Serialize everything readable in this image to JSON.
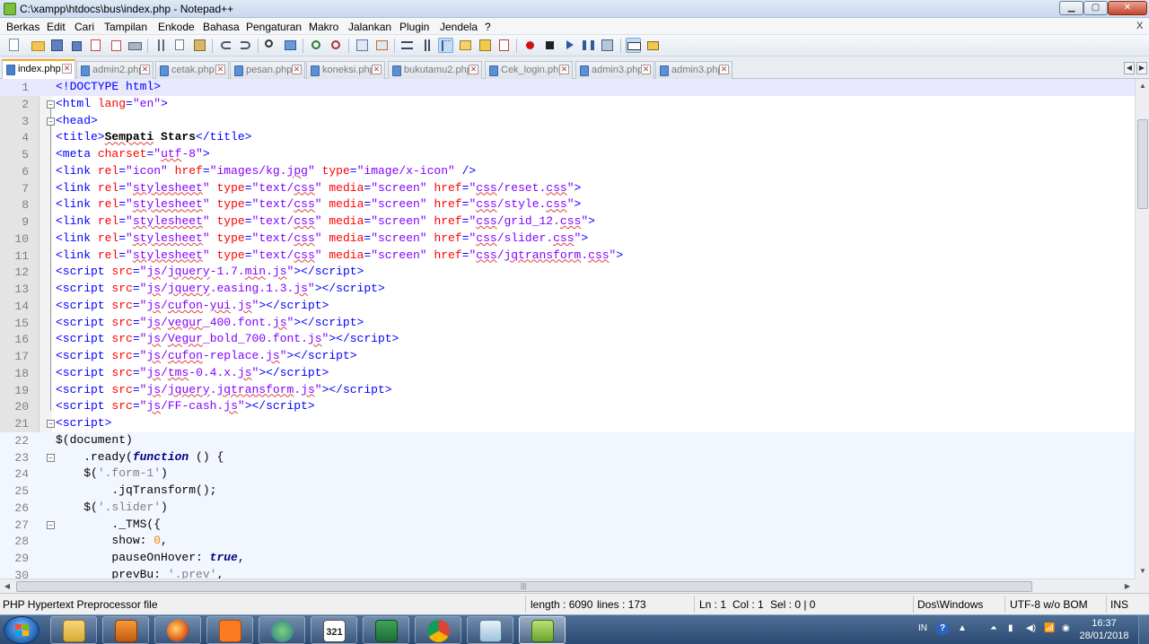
{
  "window": {
    "title": "C:\\xampp\\htdocs\\bus\\index.php - Notepad++",
    "min_glyph": "▁",
    "max_glyph": "▢",
    "close_glyph": "✕"
  },
  "menu": {
    "items": [
      "Berkas",
      "Edit",
      "Cari",
      "Tampilan",
      "Enkode",
      "Bahasa",
      "Pengaturan",
      "Makro",
      "Jalankan",
      "Plugin",
      "Jendela",
      "?"
    ],
    "close_doc_glyph": "X"
  },
  "toolbar": {
    "buttons": [
      "new-file",
      "open-file",
      "save",
      "save-all",
      "close",
      "close-all",
      "print",
      "cut",
      "copy",
      "paste",
      "undo",
      "redo",
      "find",
      "replace",
      "zoom-in",
      "zoom-out",
      "sync-vertical",
      "sync-horizontal",
      "word-wrap",
      "show-all-chars",
      "indent-guide",
      "udl",
      "doc-map",
      "function-list",
      "folder-workspace",
      "record-macro",
      "stop-recording",
      "play-macro",
      "run-macro-multiple",
      "save-macro",
      "spell-check",
      "spell-check-settings"
    ]
  },
  "tabs": [
    {
      "label": "index.php",
      "active": true
    },
    {
      "label": "admin2.php",
      "active": false
    },
    {
      "label": "cetak.php",
      "active": false
    },
    {
      "label": "pesan.php",
      "active": false
    },
    {
      "label": "koneksi.php",
      "active": false
    },
    {
      "label": "bukutamu2.php",
      "active": false
    },
    {
      "label": "Cek_login.php",
      "active": false
    },
    {
      "label": "admin3.php",
      "active": false
    },
    {
      "label": "admin3.php",
      "active": false
    }
  ],
  "tab_close_glyph": "✕",
  "tab_nav": {
    "left": "◀",
    "right": "▶"
  },
  "editor": {
    "lines": [
      {
        "n": "1",
        "html": "<span class=\"s-tag\">&lt;!DOCTYPE html&gt;</span>"
      },
      {
        "n": "2",
        "html": "<span class=\"s-tag\">&lt;html</span> <span class=\"s-attr\">lang</span><span class=\"s-tag\">=</span><span class=\"s-val\">\"en\"</span><span class=\"s-tag\">&gt;</span>"
      },
      {
        "n": "3",
        "html": "<span class=\"s-tag\">&lt;head&gt;</span>"
      },
      {
        "n": "4",
        "html": "<span class=\"s-tag\">&lt;title&gt;</span><span class=\"s-bold\"><span class=\"sq\">Sempati</span> Stars</span><span class=\"s-tag\">&lt;/title&gt;</span>"
      },
      {
        "n": "5",
        "html": "<span class=\"s-tag\">&lt;meta</span> <span class=\"s-attr\">charset</span><span class=\"s-tag\">=</span><span class=\"s-val\">\"<span class=\"sq\">utf</span>-8\"</span><span class=\"s-tag\">&gt;</span>"
      },
      {
        "n": "6",
        "html": "<span class=\"s-tag\">&lt;link</span> <span class=\"s-attr\">rel</span><span class=\"s-tag\">=</span><span class=\"s-val\">\"icon\"</span> <span class=\"s-attr\">href</span><span class=\"s-tag\">=</span><span class=\"s-val\">\"images/kg.<span class=\"sq\">jpg</span>\"</span> <span class=\"s-attr\">type</span><span class=\"s-tag\">=</span><span class=\"s-val\">\"image/x-icon\"</span> <span class=\"s-tag\">/&gt;</span>"
      },
      {
        "n": "7",
        "html": "<span class=\"s-tag\">&lt;link</span> <span class=\"s-attr\">rel</span><span class=\"s-tag\">=</span><span class=\"s-val\">\"<span class=\"sq\">stylesheet</span>\"</span> <span class=\"s-attr\">type</span><span class=\"s-tag\">=</span><span class=\"s-val\">\"text/<span class=\"sq\">css</span>\"</span> <span class=\"s-attr\">media</span><span class=\"s-tag\">=</span><span class=\"s-val\">\"screen\"</span> <span class=\"s-attr\">href</span><span class=\"s-tag\">=</span><span class=\"s-val\">\"<span class=\"sq\">css</span>/reset.<span class=\"sq\">css</span>\"</span><span class=\"s-tag\">&gt;</span>"
      },
      {
        "n": "8",
        "html": "<span class=\"s-tag\">&lt;link</span> <span class=\"s-attr\">rel</span><span class=\"s-tag\">=</span><span class=\"s-val\">\"<span class=\"sq\">stylesheet</span>\"</span> <span class=\"s-attr\">type</span><span class=\"s-tag\">=</span><span class=\"s-val\">\"text/<span class=\"sq\">css</span>\"</span> <span class=\"s-attr\">media</span><span class=\"s-tag\">=</span><span class=\"s-val\">\"screen\"</span> <span class=\"s-attr\">href</span><span class=\"s-tag\">=</span><span class=\"s-val\">\"<span class=\"sq\">css</span>/style.<span class=\"sq\">css</span>\"</span><span class=\"s-tag\">&gt;</span>"
      },
      {
        "n": "9",
        "html": "<span class=\"s-tag\">&lt;link</span> <span class=\"s-attr\">rel</span><span class=\"s-tag\">=</span><span class=\"s-val\">\"<span class=\"sq\">stylesheet</span>\"</span> <span class=\"s-attr\">type</span><span class=\"s-tag\">=</span><span class=\"s-val\">\"text/<span class=\"sq\">css</span>\"</span> <span class=\"s-attr\">media</span><span class=\"s-tag\">=</span><span class=\"s-val\">\"screen\"</span> <span class=\"s-attr\">href</span><span class=\"s-tag\">=</span><span class=\"s-val\">\"<span class=\"sq\">css</span>/grid_12.<span class=\"sq\">css</span>\"</span><span class=\"s-tag\">&gt;</span>"
      },
      {
        "n": "10",
        "html": "<span class=\"s-tag\">&lt;link</span> <span class=\"s-attr\">rel</span><span class=\"s-tag\">=</span><span class=\"s-val\">\"<span class=\"sq\">stylesheet</span>\"</span> <span class=\"s-attr\">type</span><span class=\"s-tag\">=</span><span class=\"s-val\">\"text/<span class=\"sq\">css</span>\"</span> <span class=\"s-attr\">media</span><span class=\"s-tag\">=</span><span class=\"s-val\">\"screen\"</span> <span class=\"s-attr\">href</span><span class=\"s-tag\">=</span><span class=\"s-val\">\"<span class=\"sq\">css</span>/slider.<span class=\"sq\">css</span>\"</span><span class=\"s-tag\">&gt;</span>"
      },
      {
        "n": "11",
        "html": "<span class=\"s-tag\">&lt;link</span> <span class=\"s-attr\">rel</span><span class=\"s-tag\">=</span><span class=\"s-val\">\"<span class=\"sq\">stylesheet</span>\"</span> <span class=\"s-attr\">type</span><span class=\"s-tag\">=</span><span class=\"s-val\">\"text/<span class=\"sq\">css</span>\"</span> <span class=\"s-attr\">media</span><span class=\"s-tag\">=</span><span class=\"s-val\">\"screen\"</span> <span class=\"s-attr\">href</span><span class=\"s-tag\">=</span><span class=\"s-val\">\"<span class=\"sq\">css</span>/<span class=\"sq\">jqtransform</span>.<span class=\"sq\">css</span>\"</span><span class=\"s-tag\">&gt;</span>"
      },
      {
        "n": "12",
        "html": "<span class=\"s-tag\">&lt;script</span> <span class=\"s-attr\">src</span><span class=\"s-tag\">=</span><span class=\"s-val\">\"<span class=\"sq\">js</span>/<span class=\"sq\">jquery</span>-1.7.<span class=\"sq\">min</span>.<span class=\"sq\">js</span>\"</span><span class=\"s-tag\">&gt;&lt;/script&gt;</span>"
      },
      {
        "n": "13",
        "html": "<span class=\"s-tag\">&lt;script</span> <span class=\"s-attr\">src</span><span class=\"s-tag\">=</span><span class=\"s-val\">\"<span class=\"sq\">js</span>/<span class=\"sq\">jquery</span>.easing.1.3.<span class=\"sq\">js</span>\"</span><span class=\"s-tag\">&gt;&lt;/script&gt;</span>"
      },
      {
        "n": "14",
        "html": "<span class=\"s-tag\">&lt;script</span> <span class=\"s-attr\">src</span><span class=\"s-tag\">=</span><span class=\"s-val\">\"<span class=\"sq\">js</span>/<span class=\"sq\">cufon</span>-<span class=\"sq\">yui</span>.<span class=\"sq\">js</span>\"</span><span class=\"s-tag\">&gt;&lt;/script&gt;</span>"
      },
      {
        "n": "15",
        "html": "<span class=\"s-tag\">&lt;script</span> <span class=\"s-attr\">src</span><span class=\"s-tag\">=</span><span class=\"s-val\">\"<span class=\"sq\">js</span>/<span class=\"sq\">vegur</span>_400.font.<span class=\"sq\">js</span>\"</span><span class=\"s-tag\">&gt;&lt;/script&gt;</span>"
      },
      {
        "n": "16",
        "html": "<span class=\"s-tag\">&lt;script</span> <span class=\"s-attr\">src</span><span class=\"s-tag\">=</span><span class=\"s-val\">\"<span class=\"sq\">js</span>/<span class=\"sq\">Vegur</span>_bold_700.font.<span class=\"sq\">js</span>\"</span><span class=\"s-tag\">&gt;&lt;/script&gt;</span>"
      },
      {
        "n": "17",
        "html": "<span class=\"s-tag\">&lt;script</span> <span class=\"s-attr\">src</span><span class=\"s-tag\">=</span><span class=\"s-val\">\"<span class=\"sq\">js</span>/<span class=\"sq\">cufon</span>-replace.<span class=\"sq\">js</span>\"</span><span class=\"s-tag\">&gt;&lt;/script&gt;</span>"
      },
      {
        "n": "18",
        "html": "<span class=\"s-tag\">&lt;script</span> <span class=\"s-attr\">src</span><span class=\"s-tag\">=</span><span class=\"s-val\">\"<span class=\"sq\">js</span>/<span class=\"sq\">tms</span>-0.4.x.<span class=\"sq\">js</span>\"</span><span class=\"s-tag\">&gt;&lt;/script&gt;</span>"
      },
      {
        "n": "19",
        "html": "<span class=\"s-tag\">&lt;script</span> <span class=\"s-attr\">src</span><span class=\"s-tag\">=</span><span class=\"s-val\">\"<span class=\"sq\">js</span>/<span class=\"sq\">jquery</span>.<span class=\"sq\">jqtransform</span>.<span class=\"sq\">js</span>\"</span><span class=\"s-tag\">&gt;&lt;/script&gt;</span>"
      },
      {
        "n": "20",
        "html": "<span class=\"s-tag\">&lt;script</span> <span class=\"s-attr\">src</span><span class=\"s-tag\">=</span><span class=\"s-val\">\"<span class=\"sq\">js</span>/FF-cash.<span class=\"sq\">js</span>\"</span><span class=\"s-tag\">&gt;&lt;/script&gt;</span>"
      },
      {
        "n": "21",
        "html": "<span class=\"s-tag\">&lt;script&gt;</span>"
      },
      {
        "n": "22",
        "html": "$(document)"
      },
      {
        "n": "23",
        "html": "    .ready(<span class=\"s-kw\">function</span> () {"
      },
      {
        "n": "24",
        "html": "    $(<span class=\"s-str\">'.form-1'</span>)"
      },
      {
        "n": "25",
        "html": "        .jqTransform();"
      },
      {
        "n": "26",
        "html": "    $(<span class=\"s-str\">'.slider'</span>)"
      },
      {
        "n": "27",
        "html": "        ._TMS({"
      },
      {
        "n": "28",
        "html": "        show: <span class=\"s-num\">0</span>,"
      },
      {
        "n": "29",
        "html": "        pauseOnHover: <span class=\"s-kw\">true</span>,"
      },
      {
        "n": "30",
        "html": "        prevBu: <span class=\"s-str\">'.prev'</span>,"
      }
    ],
    "fold_markers": {
      "2": "−",
      "3": "−",
      "21": "−",
      "23": "−",
      "27": "−"
    },
    "current_line": 1
  },
  "statusbar": {
    "file_type": "PHP Hypertext Preprocessor file",
    "length": "length : 6090",
    "lines": "lines : 173",
    "ln": "Ln : 1",
    "col": "Col : 1",
    "sel": "Sel : 0 | 0",
    "eol": "Dos\\Windows",
    "encoding": "UTF-8 w/o BOM",
    "mode": "INS"
  },
  "scroll": {
    "up": "▲",
    "down": "▼",
    "left": "◀",
    "right": "▶",
    "grip": "|||"
  },
  "taskbar": {
    "apps": [
      "file-explorer",
      "media-player",
      "firefox",
      "xampp",
      "network-app",
      "calendar-app",
      "excel",
      "chrome",
      "notes-app",
      "notepad-plus-plus"
    ],
    "calendar_text": "321",
    "tray": {
      "lang": "IN",
      "help_glyph": "?",
      "arrow_glyph": "▲",
      "icon_glyphs": [
        "⏶",
        "▮",
        "◀)",
        "📶",
        "◉"
      ]
    },
    "time": "16:37",
    "date": "28/01/2018"
  },
  "colors": {
    "tag": "#0000ff",
    "attribute": "#ff0000",
    "value": "#8000ff",
    "string": "#808080",
    "number": "#ff8000",
    "keyword": "#000080"
  }
}
